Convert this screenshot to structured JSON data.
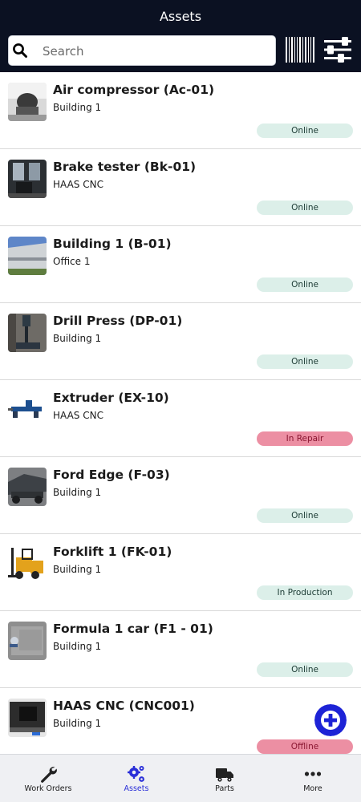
{
  "header": {
    "title": "Assets"
  },
  "search": {
    "placeholder": "Search",
    "value": ""
  },
  "assets": [
    {
      "name": "Air compressor (Ac-01)",
      "location": "Building 1",
      "status": "Online"
    },
    {
      "name": "Brake tester (Bk-01)",
      "location": "HAAS CNC",
      "status": "Online"
    },
    {
      "name": "Building 1 (B-01)",
      "location": "Office 1",
      "status": "Online"
    },
    {
      "name": "Drill Press (DP-01)",
      "location": "Building 1",
      "status": "Online"
    },
    {
      "name": "Extruder (EX-10)",
      "location": "HAAS CNC",
      "status": "In Repair"
    },
    {
      "name": "Ford Edge (F-03)",
      "location": "Building 1",
      "status": "Online"
    },
    {
      "name": "Forklift 1 (FK-01)",
      "location": "Building 1",
      "status": "In Production"
    },
    {
      "name": "Formula 1 car (F1 - 01)",
      "location": "Building 1",
      "status": "Online"
    },
    {
      "name": "HAAS CNC (CNC001)",
      "location": "Building 1",
      "status": "Offline"
    }
  ],
  "status_colors": {
    "Online": {
      "bg": "#dcefe9",
      "fg": "#1b3a33"
    },
    "In Production": {
      "bg": "#dcefe9",
      "fg": "#1b3a33"
    },
    "In Repair": {
      "bg": "#ec8fa3",
      "fg": "#8a1631"
    },
    "Offline": {
      "bg": "#ec8fa3",
      "fg": "#8a1631"
    }
  },
  "tabs": [
    {
      "label": "Work Orders",
      "icon": "wrench-icon",
      "active": false
    },
    {
      "label": "Assets",
      "icon": "gears-icon",
      "active": true
    },
    {
      "label": "Parts",
      "icon": "truck-icon",
      "active": false
    },
    {
      "label": "More",
      "icon": "more-dots-icon",
      "active": false
    }
  ],
  "colors": {
    "header_bg": "#0b1122",
    "accent": "#2a2fd8",
    "fab": "#1d23d6",
    "tabbar_bg": "#eff0f3"
  }
}
